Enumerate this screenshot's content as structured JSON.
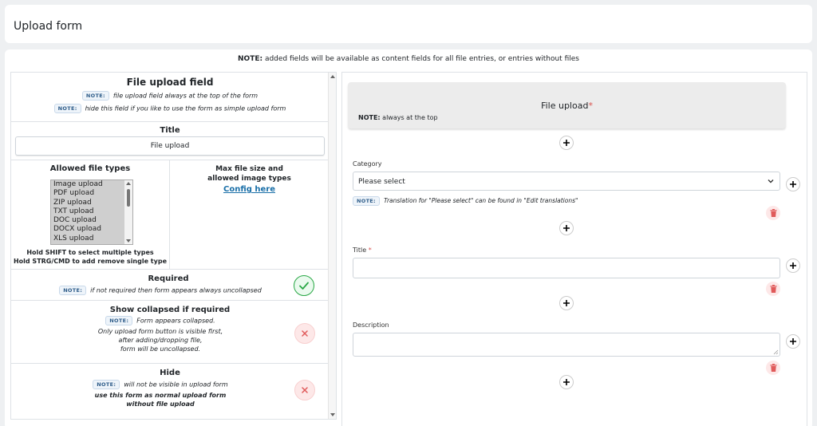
{
  "header": {
    "title": "Upload form"
  },
  "top_note": {
    "label": "NOTE:",
    "text": " added fields will be available as content fields for all file entries, or entries without files"
  },
  "left": {
    "file_upload_field": {
      "title": "File upload field",
      "notes": [
        {
          "badge": "NOTE:",
          "text": "file upload field always at the top of the form"
        },
        {
          "badge": "NOTE:",
          "text": "hide this field if you like to use the form as simple upload form"
        }
      ]
    },
    "title_section": {
      "label": "Title",
      "value": "File upload"
    },
    "allowed_types": {
      "label": "Allowed file types",
      "options": [
        "Image upload",
        "PDF upload",
        "ZIP upload",
        "TXT upload",
        "DOC upload",
        "DOCX upload",
        "XLS upload"
      ],
      "hint1": "Hold SHIFT to select multiple types",
      "hint2": "Hold STRG/CMD to add remove single type"
    },
    "max_size": {
      "line1": "Max file size and",
      "line2": "allowed image types",
      "link": "Config here"
    },
    "required": {
      "label": "Required",
      "badge": "NOTE:",
      "note": "if not required then form appears always uncollapsed"
    },
    "show_collapsed": {
      "label": "Show collapsed if required",
      "badge": "NOTE:",
      "note": "Form appears collapsed.",
      "lines": [
        "Only upload form button is visible first,",
        "after adding/dropping file,",
        "form will be uncollapsed."
      ]
    },
    "hide": {
      "label": "Hide",
      "badge": "NOTE:",
      "note": "will not be visible in upload form",
      "lines": [
        "use this form as normal upload form",
        "without file upload"
      ]
    }
  },
  "right": {
    "file_upload": {
      "title": "File upload",
      "required_mark": "*",
      "note_label": "NOTE:",
      "note_text": " always at the top"
    },
    "category": {
      "label": "Category",
      "selected": "Please select",
      "badge": "NOTE:",
      "note": "Translation for \"Please select\" can be found in \"Edit translations\""
    },
    "title": {
      "label": "Title",
      "required_mark": "*"
    },
    "description": {
      "label": "Description"
    }
  },
  "colors": {
    "accent": "#1a6fa8",
    "success": "#28a745",
    "danger": "#e05a5a",
    "required": "#d9534f"
  }
}
